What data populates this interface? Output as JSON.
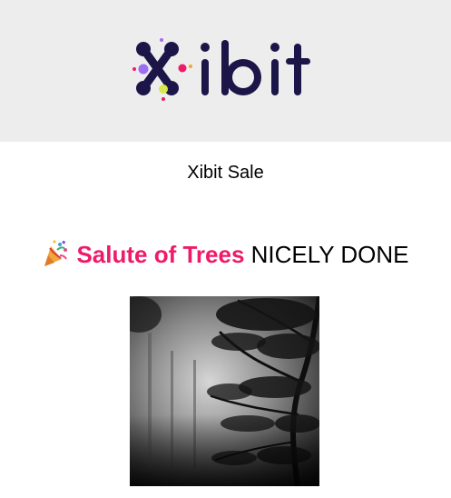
{
  "header": {
    "brand_name": "Xibit",
    "logo_text": "ibit",
    "background": "#ededed",
    "logo_color": "#1b1548"
  },
  "email": {
    "subject": "Xibit Sale"
  },
  "sale": {
    "emoji_icon": "party-popper-icon",
    "artwork_title": "Salute of Trees",
    "status_text": "NICELY DONE",
    "title_color": "#ee1a6a"
  },
  "artwork": {
    "description_icon": "forest-photo"
  }
}
